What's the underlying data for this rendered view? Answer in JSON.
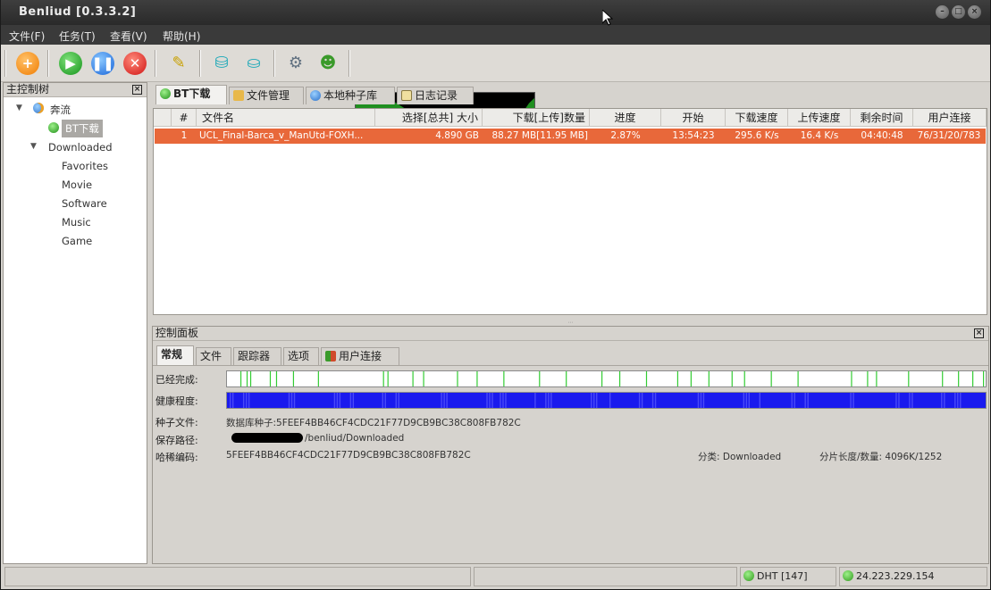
{
  "window": {
    "title": "Benliud [0.3.3.2]"
  },
  "menu": [
    "文件(F)",
    "任务(T)",
    "查看(V)",
    "帮助(H)"
  ],
  "sidebar": {
    "title": "主控制树",
    "items": {
      "root": "奔流",
      "bt": "BT下载",
      "downloaded": "Downloaded",
      "favorites": "Favorites",
      "movie": "Movie",
      "software": "Software",
      "music": "Music",
      "game": "Game"
    }
  },
  "tabs": [
    "BT下载",
    "文件管理",
    "本地种子库",
    "日志记录"
  ],
  "table": {
    "headers": [
      "#",
      "文件名",
      "选择[总共] 大小",
      "下载[上传]数量",
      "进度",
      "开始",
      "下载速度",
      "上传速度",
      "剩余时间",
      "用户连接"
    ],
    "row": [
      "1",
      "UCL_Final-Barca_v_ManUtd-FOXH...",
      "4.890 GB",
      "88.27 MB[11.95 MB]",
      "2.87%",
      "13:54:23",
      "295.6 K/s",
      "16.4 K/s",
      "04:40:48",
      "76/31/20/783"
    ]
  },
  "control": {
    "title": "控制面板",
    "tabs": [
      "常规",
      "文件",
      "跟踪器",
      "选项",
      "用户连接"
    ],
    "completed_label": "已经完成:",
    "health_label": "健康程度:",
    "seed_label": "种子文件:",
    "seed_value": "数据库种子:5FEEF4BB46CF4CDC21F77D9CB9BC38C808FB782C",
    "path_label": "保存路径:",
    "path_value": "/benliud/Downloaded",
    "hash_label": "哈稀编码:",
    "hash_value": "5FEEF4BB46CF4CDC21F77D9CB9BC38C808FB782C",
    "category": "分类: Downloaded",
    "pieces": "分片长度/数量: 4096K/1252"
  },
  "status": {
    "dht": "DHT [147]",
    "ip": "24.223.229.154"
  },
  "colors": {
    "accent": "#e8683a",
    "health": "#1a1aee",
    "complete": "#33cc33"
  }
}
